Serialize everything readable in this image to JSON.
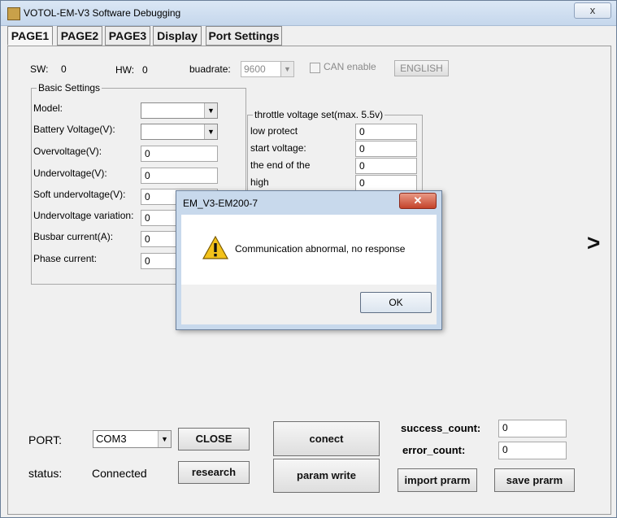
{
  "window": {
    "title": "VOTOL-EM-V3 Software Debugging",
    "close_glyph": "x"
  },
  "tabs": [
    "PAGE1",
    "PAGE2",
    "PAGE3",
    "Display",
    "Port Settings"
  ],
  "info_row": {
    "sw_label": "SW:",
    "sw_value": "0",
    "hw_label": "HW:",
    "hw_value": "0",
    "baudrate_label": "buadrate:",
    "baudrate_value": "9600",
    "can_label": "CAN enable",
    "language_button": "ENGLISH"
  },
  "basic_settings": {
    "caption": "Basic Settings",
    "rows": [
      {
        "label": "Model:",
        "type": "combo",
        "value": ""
      },
      {
        "label": "Battery Voltage(V):",
        "type": "combo",
        "value": ""
      },
      {
        "label": "Overvoltage(V):",
        "type": "field",
        "value": "0"
      },
      {
        "label": "Undervoltage(V):",
        "type": "field",
        "value": "0"
      },
      {
        "label": "Soft undervoltage(V):",
        "type": "field",
        "value": "0"
      },
      {
        "label": "Undervoltage variation:",
        "type": "field",
        "value": "0"
      },
      {
        "label": "Busbar current(A):",
        "type": "field",
        "value": "0"
      },
      {
        "label": "Phase current:",
        "type": "field",
        "value": "0"
      }
    ]
  },
  "throttle": {
    "caption": "throttle voltage set(max. 5.5v)",
    "rows": [
      {
        "label": "low protect",
        "value": "0"
      },
      {
        "label": "start voltage:",
        "value": "0"
      },
      {
        "label": "the end of the",
        "value": "0"
      },
      {
        "label": "high",
        "value": "0"
      }
    ]
  },
  "bottom": {
    "port_label": "PORT:",
    "port_value": "COM3",
    "close_button": "CLOSE",
    "status_label": "status:",
    "status_value": "Connected",
    "research_button": "research",
    "connect_button": "conect",
    "param_write_button": "param write",
    "success_label": "success_count:",
    "success_value": "0",
    "error_label": "error_count:",
    "error_value": "0",
    "import_button": "import prarm",
    "save_button": "save prarm"
  },
  "next_glyph": ">",
  "dialog": {
    "title": "EM_V3-EM200-7",
    "message": "Communication abnormal, no response",
    "ok_button": "OK",
    "icon": "warning-icon"
  }
}
